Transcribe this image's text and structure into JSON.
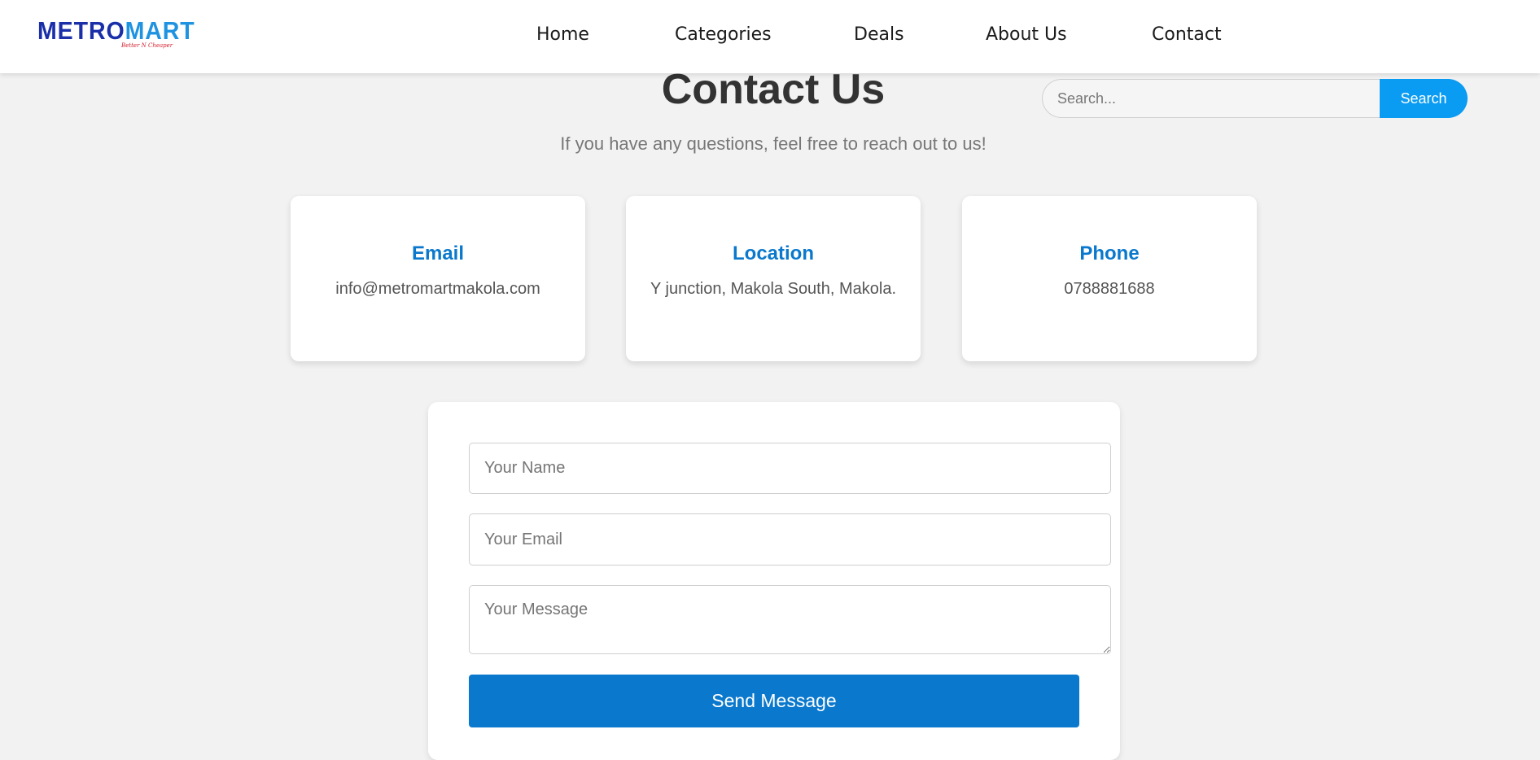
{
  "header": {
    "logo": {
      "text_part1": "METRO",
      "text_part2": "MART",
      "tagline": "Better N Cheaper"
    },
    "nav": [
      "Home",
      "Categories",
      "Deals",
      "About Us",
      "Contact"
    ]
  },
  "search": {
    "placeholder": "Search...",
    "button_label": "Search"
  },
  "main": {
    "title": "Contact Us",
    "subtitle": "If you have any questions, feel free to reach out to us!",
    "cards": [
      {
        "title": "Email",
        "value": "info@metromartmakola.com"
      },
      {
        "title": "Location",
        "value": "Y junction, Makola South, Makola."
      },
      {
        "title": "Phone",
        "value": "0788881688"
      }
    ]
  },
  "form": {
    "name_placeholder": "Your Name",
    "email_placeholder": "Your Email",
    "message_placeholder": "Your Message",
    "submit_label": "Send Message"
  },
  "colors": {
    "accent": "#0a78cc",
    "search_button": "#0a9bf2",
    "background": "#f2f2f2",
    "logo_blue": "#1f93e0",
    "logo_navy": "#1a2fa8",
    "logo_tagline": "#d3202f"
  }
}
